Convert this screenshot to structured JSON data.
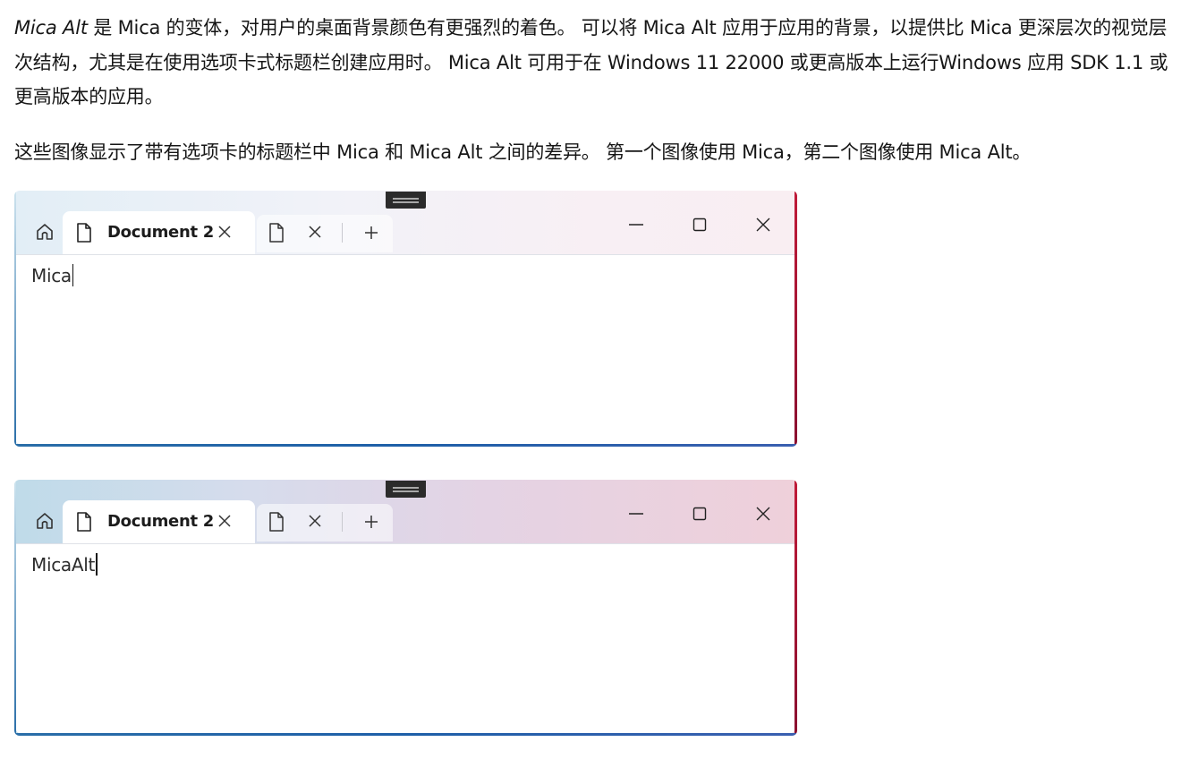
{
  "paragraph1": {
    "lead_italic": "Mica Alt",
    "text": " 是 Mica 的变体，对用户的桌面背景颜色有更强烈的着色。 可以将 Mica Alt 应用于应用的背景，以提供比 Mica 更深层次的视觉层次结构，尤其是在使用选项卡式标题栏创建应用时。 Mica Alt 可用于在 Windows 11 22000 或更高版本上运行Windows 应用 SDK 1.1 或更高版本的应用。"
  },
  "paragraph2": "这些图像显示了带有选项卡的标题栏中 Mica 和 Mica Alt 之间的差异。 第一个图像使用 Mica，第二个图像使用 Mica Alt。",
  "windows": [
    {
      "tab_title": "Document 2",
      "content_text": "Mica"
    },
    {
      "tab_title": "Document 2",
      "content_text": "MicaAlt"
    }
  ],
  "icons": {
    "home": "home-icon",
    "document": "document-icon",
    "close_tab": "close-icon",
    "new_tab": "plus-icon",
    "minimize": "minimize-icon",
    "maximize": "maximize-icon",
    "close_window": "close-icon"
  },
  "colors": {
    "accent_edge_right": "#c01a38",
    "accent_edge_bottom": "#1e5fa8"
  }
}
